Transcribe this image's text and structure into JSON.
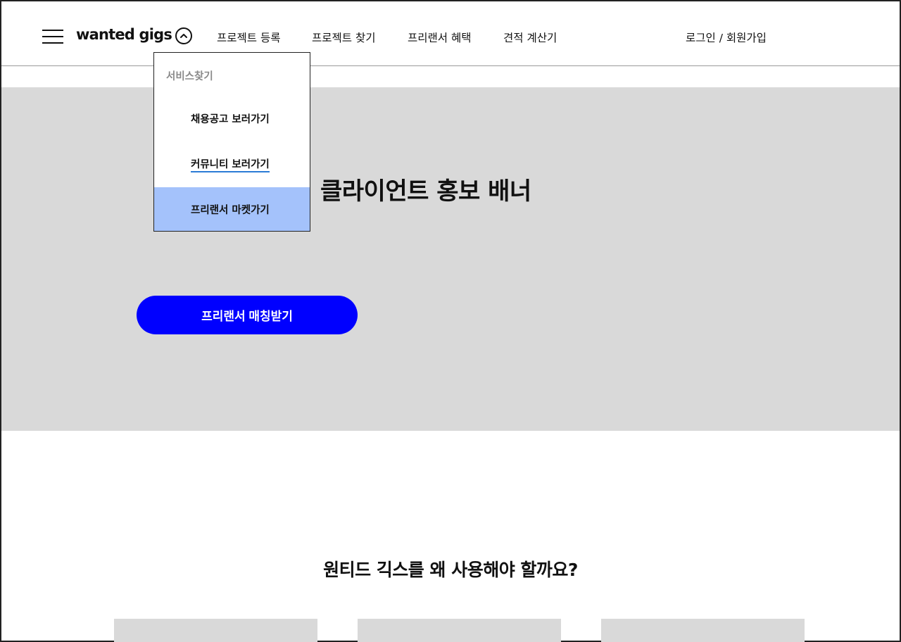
{
  "header": {
    "logo": "wanted gigs",
    "nav": [
      "프로젝트 등록",
      "프로젝트 찾기",
      "프리랜서 혜택",
      "견적 계산기"
    ],
    "login": "로그인 / 회원가입"
  },
  "dropdown": {
    "heading": "서비스찾기",
    "items": [
      "채용공고 보러가기",
      "커뮤니티 보러가기",
      "프리랜서 마켓가기"
    ],
    "highlighted_item_index": 2,
    "highlight_color": "#a4c2fb",
    "underline_color": "#2b7bd6"
  },
  "banner": {
    "title": "클라이언트 홍보 배너",
    "cta": "프리랜서 매칭받기",
    "background": "#d9d9d9",
    "cta_color": "#0000ff"
  },
  "section": {
    "title": "원티드 긱스를 왜 사용해야 할까요?"
  }
}
